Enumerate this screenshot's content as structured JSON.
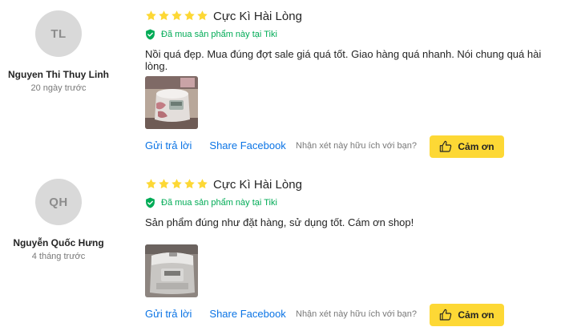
{
  "reviews": [
    {
      "initials": "TL",
      "name": "Nguyen Thi Thuy Linh",
      "date": "20 ngày trước",
      "rating": 5,
      "title": "Cực Kì Hài Lòng",
      "verified": "Đã mua sản phẩm này tại Tiki",
      "content": "Nồi quá đẹp. Mua đúng đợt sale giá quá tốt. Giao hàng quá nhanh. Nói chung quá hài lòng.",
      "reply": "Gửi trả lời",
      "share": "Share Facebook",
      "question": "Nhận xét này hữu ích với bạn?",
      "thanks": "Cảm ơn"
    },
    {
      "initials": "QH",
      "name": "Nguyễn Quốc Hưng",
      "date": "4 tháng trước",
      "rating": 5,
      "title": "Cực Kì Hài Lòng",
      "verified": "Đã mua sản phẩm này tại Tiki",
      "content": "Sản phẩm đúng như đặt hàng, sử dụng tốt. Cám ơn shop!",
      "reply": "Gửi trả lời",
      "share": "Share Facebook",
      "question": "Nhận xét này hữu ích với bạn?",
      "thanks": "Cảm ơn"
    }
  ],
  "colors": {
    "star": "#fdd835",
    "verified": "#00ab56",
    "link": "#0b74e5",
    "button": "#fdd835",
    "avatar_bg": "#d9d9d9"
  },
  "icons": {
    "star": "star-icon",
    "verified": "shield-check-icon",
    "thanks": "thumbs-up-icon"
  }
}
